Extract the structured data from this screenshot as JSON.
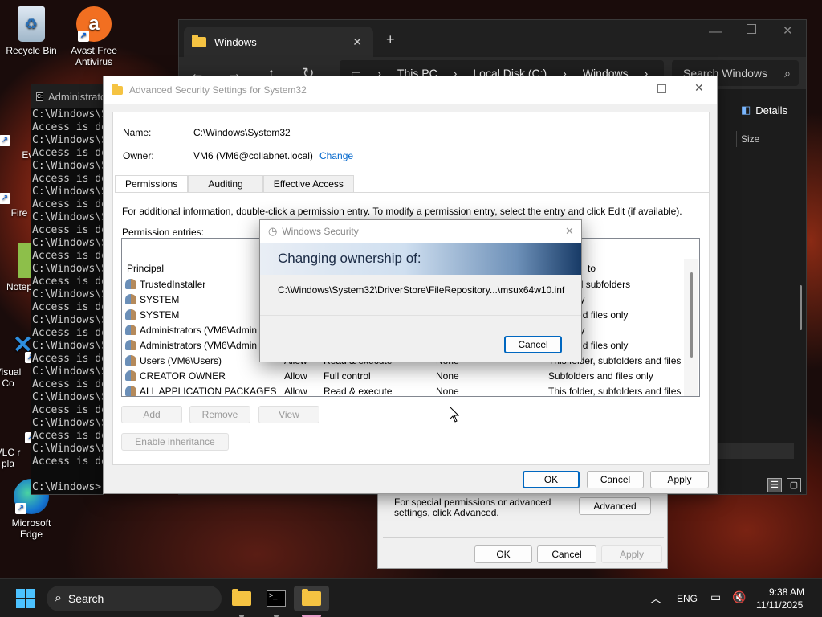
{
  "desktop": {
    "icons": [
      {
        "label": "Recycle Bin"
      },
      {
        "label": "Avast Free Antivirus"
      },
      {
        "label": "Every"
      },
      {
        "label": "Fire"
      },
      {
        "label": "Notep"
      },
      {
        "label": "Visual Co"
      },
      {
        "label": "VLC r pla"
      },
      {
        "label": "Microsoft Edge"
      }
    ]
  },
  "explorer": {
    "tab_title": "Windows",
    "breadcrumb": [
      "This PC",
      "Local Disk (C:)",
      "Windows"
    ],
    "search_placeholder": "Search Windows",
    "details_label": "Details",
    "column_size": "Size"
  },
  "cmd": {
    "title": "Administrator: Command Prompt",
    "lines": [
      "C:\\Windows\\System32>",
      "Access is denied.",
      "C:\\Windows\\System32>",
      "Access is denied.",
      "C:\\Windows\\System32>",
      "Access is denied.",
      "C:\\Windows\\System32>",
      "Access is denied.",
      "C:\\Windows\\System32>",
      "Access is denied.",
      "C:\\Windows\\System32>",
      "Access is denied.",
      "C:\\Windows\\System32>",
      "Access is denied.",
      "C:\\Windows\\System32>",
      "Access is denied.",
      "C:\\Windows\\System32>",
      "Access is denied.",
      "C:\\Windows\\System32>",
      "Access is denied.",
      "C:\\Windows\\System32>",
      "Access is denied.",
      "C:\\Windows\\System32>",
      "Access is denied.",
      "C:\\Windows\\System32>",
      "Access is denied.",
      "C:\\Windows\\System32>",
      "Access is denied.",
      "",
      "C:\\Windows>"
    ]
  },
  "advanced": {
    "title": "Advanced Security Settings for System32",
    "name_label": "Name:",
    "name_value": "C:\\Windows\\System32",
    "owner_label": "Owner:",
    "owner_value": "VM6 (VM6@collabnet.local)",
    "change_link": "Change",
    "tabs": [
      "Permissions",
      "Auditing",
      "Effective Access"
    ],
    "info_text": "For additional information, double-click a permission entry. To modify a permission entry, select the entry and click Edit (if available).",
    "entries_label": "Permission entries:",
    "columns": {
      "principal": "Principal",
      "applies": "to"
    },
    "rows": [
      {
        "principal": "TrustedInstaller",
        "type": "",
        "access": "",
        "inherited": "",
        "applies": "lder and subfolders"
      },
      {
        "principal": "SYSTEM",
        "type": "",
        "access": "",
        "inherited": "",
        "applies": "lder only"
      },
      {
        "principal": "SYSTEM",
        "type": "",
        "access": "",
        "inherited": "",
        "applies": "lders and files only"
      },
      {
        "principal": "Administrators (VM6\\Admin",
        "type": "",
        "access": "",
        "inherited": "",
        "applies": "lder only"
      },
      {
        "principal": "Administrators (VM6\\Admin",
        "type": "",
        "access": "",
        "inherited": "",
        "applies": "lders and files only"
      },
      {
        "principal": "Users (VM6\\Users)",
        "type": "Allow",
        "access": "Read & execute",
        "inherited": "None",
        "applies": "This folder, subfolders and files"
      },
      {
        "principal": "CREATOR OWNER",
        "type": "Allow",
        "access": "Full control",
        "inherited": "None",
        "applies": "Subfolders and files only"
      },
      {
        "principal": "ALL APPLICATION PACKAGES",
        "type": "Allow",
        "access": "Read & execute",
        "inherited": "None",
        "applies": "This folder, subfolders and files"
      }
    ],
    "add_btn": "Add",
    "remove_btn": "Remove",
    "view_btn": "View",
    "enable_inheritance_btn": "Enable inheritance",
    "ok_btn": "OK",
    "cancel_btn": "Cancel",
    "apply_btn": "Apply"
  },
  "props": {
    "info": "For special permissions or advanced settings, click Advanced.",
    "advanced_btn": "Advanced",
    "ok_btn": "OK",
    "cancel_btn": "Cancel",
    "apply_btn": "Apply"
  },
  "security_dialog": {
    "title": "Windows Security",
    "heading": "Changing ownership of:",
    "path": "C:\\Windows\\System32\\DriverStore\\FileRepository...\\msux64w10.inf",
    "cancel_btn": "Cancel"
  },
  "taskbar": {
    "search_label": "Search",
    "language": "ENG",
    "time": "9:38 AM",
    "date": "11/11/2025"
  }
}
